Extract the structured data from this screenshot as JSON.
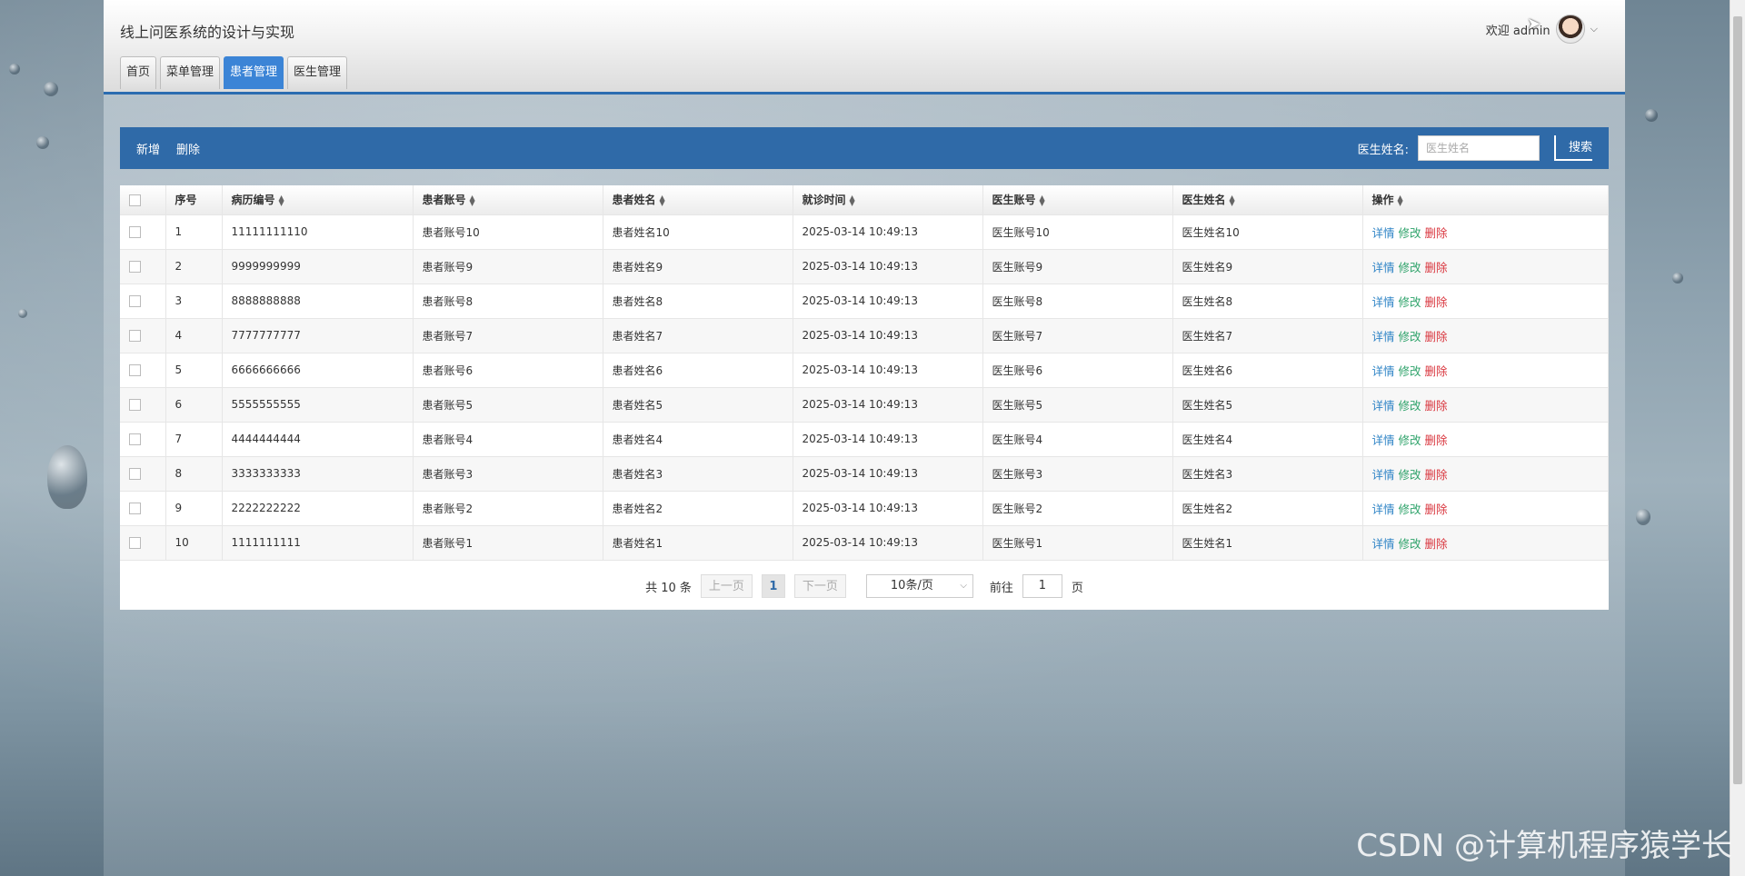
{
  "header": {
    "site_title": "线上问医系统的设计与实现",
    "welcome_text": "欢迎 admin"
  },
  "nav": [
    {
      "label": "首页",
      "active": false
    },
    {
      "label": "菜单管理",
      "active": false
    },
    {
      "label": "患者管理",
      "active": true
    },
    {
      "label": "医生管理",
      "active": false
    }
  ],
  "toolbar": {
    "add_label": "新增",
    "delete_label": "删除",
    "search_label": "医生姓名:",
    "search_placeholder": "医生姓名",
    "search_button": "搜索"
  },
  "table": {
    "headers": [
      "序号",
      "病历编号",
      "患者账号",
      "患者姓名",
      "就诊时间",
      "医生账号",
      "医生姓名",
      "操作"
    ],
    "actions": {
      "detail": "详情",
      "edit": "修改",
      "delete": "删除"
    },
    "rows": [
      {
        "no": "1",
        "record": "11111111110",
        "patient_account": "患者账号10",
        "patient_name": "患者姓名10",
        "time": "2025-03-14 10:49:13",
        "doctor_account": "医生账号10",
        "doctor_name": "医生姓名10"
      },
      {
        "no": "2",
        "record": "9999999999",
        "patient_account": "患者账号9",
        "patient_name": "患者姓名9",
        "time": "2025-03-14 10:49:13",
        "doctor_account": "医生账号9",
        "doctor_name": "医生姓名9"
      },
      {
        "no": "3",
        "record": "8888888888",
        "patient_account": "患者账号8",
        "patient_name": "患者姓名8",
        "time": "2025-03-14 10:49:13",
        "doctor_account": "医生账号8",
        "doctor_name": "医生姓名8"
      },
      {
        "no": "4",
        "record": "7777777777",
        "patient_account": "患者账号7",
        "patient_name": "患者姓名7",
        "time": "2025-03-14 10:49:13",
        "doctor_account": "医生账号7",
        "doctor_name": "医生姓名7"
      },
      {
        "no": "5",
        "record": "6666666666",
        "patient_account": "患者账号6",
        "patient_name": "患者姓名6",
        "time": "2025-03-14 10:49:13",
        "doctor_account": "医生账号6",
        "doctor_name": "医生姓名6"
      },
      {
        "no": "6",
        "record": "5555555555",
        "patient_account": "患者账号5",
        "patient_name": "患者姓名5",
        "time": "2025-03-14 10:49:13",
        "doctor_account": "医生账号5",
        "doctor_name": "医生姓名5"
      },
      {
        "no": "7",
        "record": "4444444444",
        "patient_account": "患者账号4",
        "patient_name": "患者姓名4",
        "time": "2025-03-14 10:49:13",
        "doctor_account": "医生账号4",
        "doctor_name": "医生姓名4"
      },
      {
        "no": "8",
        "record": "3333333333",
        "patient_account": "患者账号3",
        "patient_name": "患者姓名3",
        "time": "2025-03-14 10:49:13",
        "doctor_account": "医生账号3",
        "doctor_name": "医生姓名3"
      },
      {
        "no": "9",
        "record": "2222222222",
        "patient_account": "患者账号2",
        "patient_name": "患者姓名2",
        "time": "2025-03-14 10:49:13",
        "doctor_account": "医生账号2",
        "doctor_name": "医生姓名2"
      },
      {
        "no": "10",
        "record": "1111111111",
        "patient_account": "患者账号1",
        "patient_name": "患者姓名1",
        "time": "2025-03-14 10:49:13",
        "doctor_account": "医生账号1",
        "doctor_name": "医生姓名1"
      }
    ]
  },
  "pagination": {
    "total_text": "共 10 条",
    "prev_label": "上一页",
    "current_page": "1",
    "next_label": "下一页",
    "page_size": "10条/页",
    "goto_label": "前往",
    "goto_value": "1",
    "page_suffix": "页"
  },
  "watermark": "CSDN @计算机程序猿学长",
  "colors": {
    "toolbar": "#2f6aa8",
    "active_tab": "#3b84d6",
    "detail": "#2f84c6",
    "edit": "#2fa36b",
    "delete": "#d9363e"
  }
}
